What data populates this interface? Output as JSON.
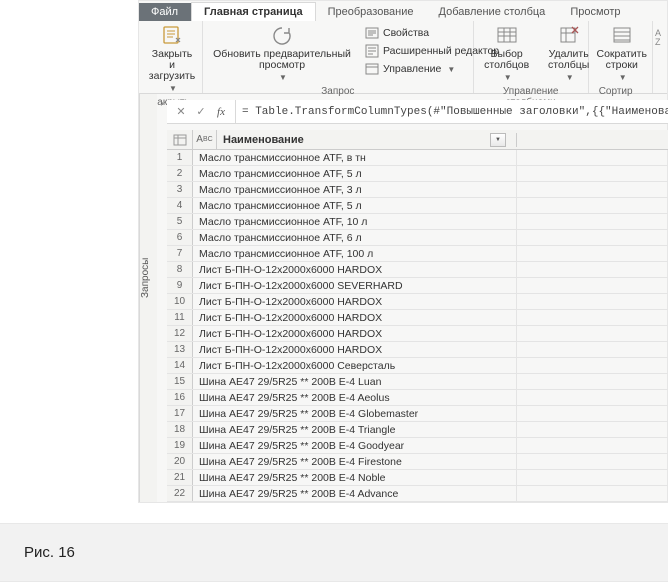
{
  "tabs": {
    "file": "Файл",
    "home": "Главная страница",
    "transform": "Преобразование",
    "addcol": "Добавление столбца",
    "view": "Просмотр"
  },
  "ribbon": {
    "close": {
      "label": "Закрыть",
      "btn": "Закрыть и\nзагрузить"
    },
    "query": {
      "label": "Запрос",
      "refresh": "Обновить предварительный\nпросмотр",
      "props": "Свойства",
      "advanced": "Расширенный редактор",
      "manage": "Управление"
    },
    "cols": {
      "label": "Управление столбцами",
      "choose": "Выбор\nстолбцов",
      "remove": "Удалить\nстолбцы"
    },
    "rows": {
      "label": "Сортир",
      "reduce": "Сократить\nстроки"
    }
  },
  "sidebar": {
    "label": "Запросы"
  },
  "formula": "= Table.TransformColumnTypes(#\"Повышенные  заголовки\",{{\"Наименование\", t",
  "column": {
    "type": "ABC",
    "name": "Наименование"
  },
  "chart_data": {
    "type": "table",
    "columns": [
      "Наименование"
    ],
    "rows": [
      "Масло трансмиссионное ATF, в тн",
      "Масло трансмиссионное ATF, 5 л",
      "Масло трансмиссионное ATF, 3 л",
      "Масло трансмиссионное ATF, 5 л",
      "Масло трансмиссионное ATF, 10 л",
      "Масло трансмиссионное ATF, 6 л",
      "Масло трансмиссионное ATF, 100 л",
      "Лист Б-ПН-О-12х2000х6000 HARDOX",
      "Лист Б-ПН-О-12х2000х6000 SEVERHARD",
      "Лист Б-ПН-О-12х2000х6000 HARDOX",
      "Лист Б-ПН-О-12х2000х6000 HARDOX",
      "Лист Б-ПН-О-12х2000х6000 HARDOX",
      "Лист Б-ПН-О-12х2000х6000 HARDOX",
      "Лист Б-ПН-О-12х2000х6000 Северсталь",
      "Шина AE47 29/5R25 ** 200B E-4 Luan",
      "Шина AE47 29/5R25 ** 200B E-4 Aeolus",
      "Шина AE47 29/5R25 ** 200B E-4 Globemaster",
      "Шина AE47 29/5R25 ** 200B E-4 Triangle",
      "Шина AE47 29/5R25 ** 200B E-4 Goodyear",
      "Шина AE47 29/5R25 ** 200B E-4 Firestone",
      "Шина AE47 29/5R25 ** 200B E-4 Noble",
      "Шина AE47 29/5R25 ** 200B E-4 Advance"
    ]
  },
  "caption": "Рис. 16"
}
